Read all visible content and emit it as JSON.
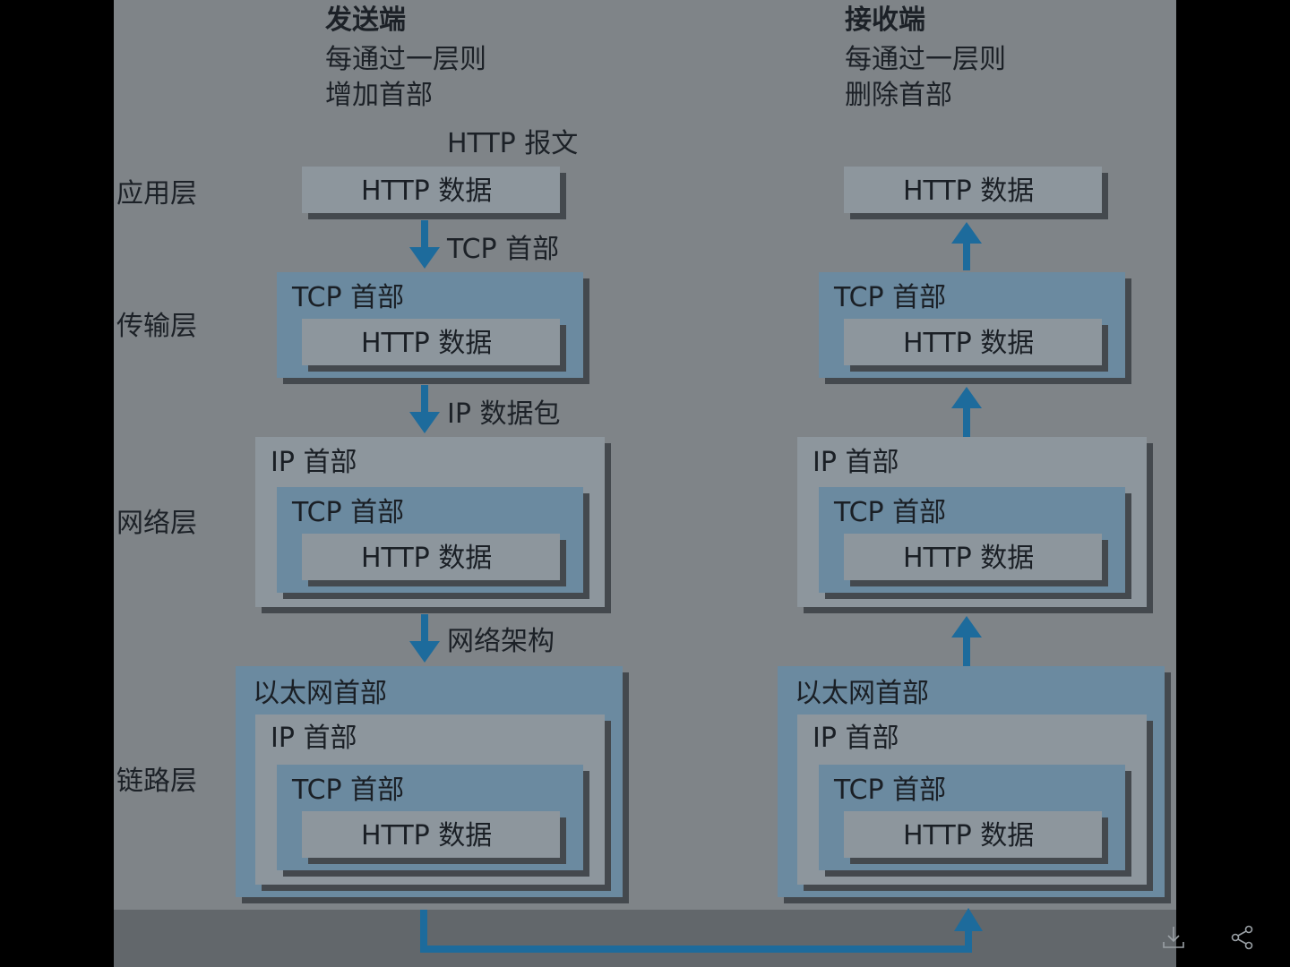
{
  "sender": {
    "title": "发送端",
    "desc_line1": "每通过一层则",
    "desc_line2": "增加首部",
    "message_label": "HTTP 报文"
  },
  "receiver": {
    "title": "接收端",
    "desc_line1": "每通过一层则",
    "desc_line2": "删除首部"
  },
  "layers": {
    "application": "应用层",
    "transport": "传输层",
    "network": "网络层",
    "link": "链路层"
  },
  "labels": {
    "http_data": "HTTP 数据",
    "tcp_header": "TCP 首部",
    "ip_header": "IP 首部",
    "ethernet_header": "以太网首部"
  },
  "arrows": {
    "tcp_header": "TCP 首部",
    "ip_packet": "IP 数据包",
    "network_arch": "网络架构"
  },
  "colors": {
    "blue_box": "#6b8aa0",
    "gray_box": "#8d969d",
    "arrow": "#1d6b9c",
    "background": "#7f8488"
  },
  "icons": [
    "download-icon",
    "share-icon"
  ]
}
